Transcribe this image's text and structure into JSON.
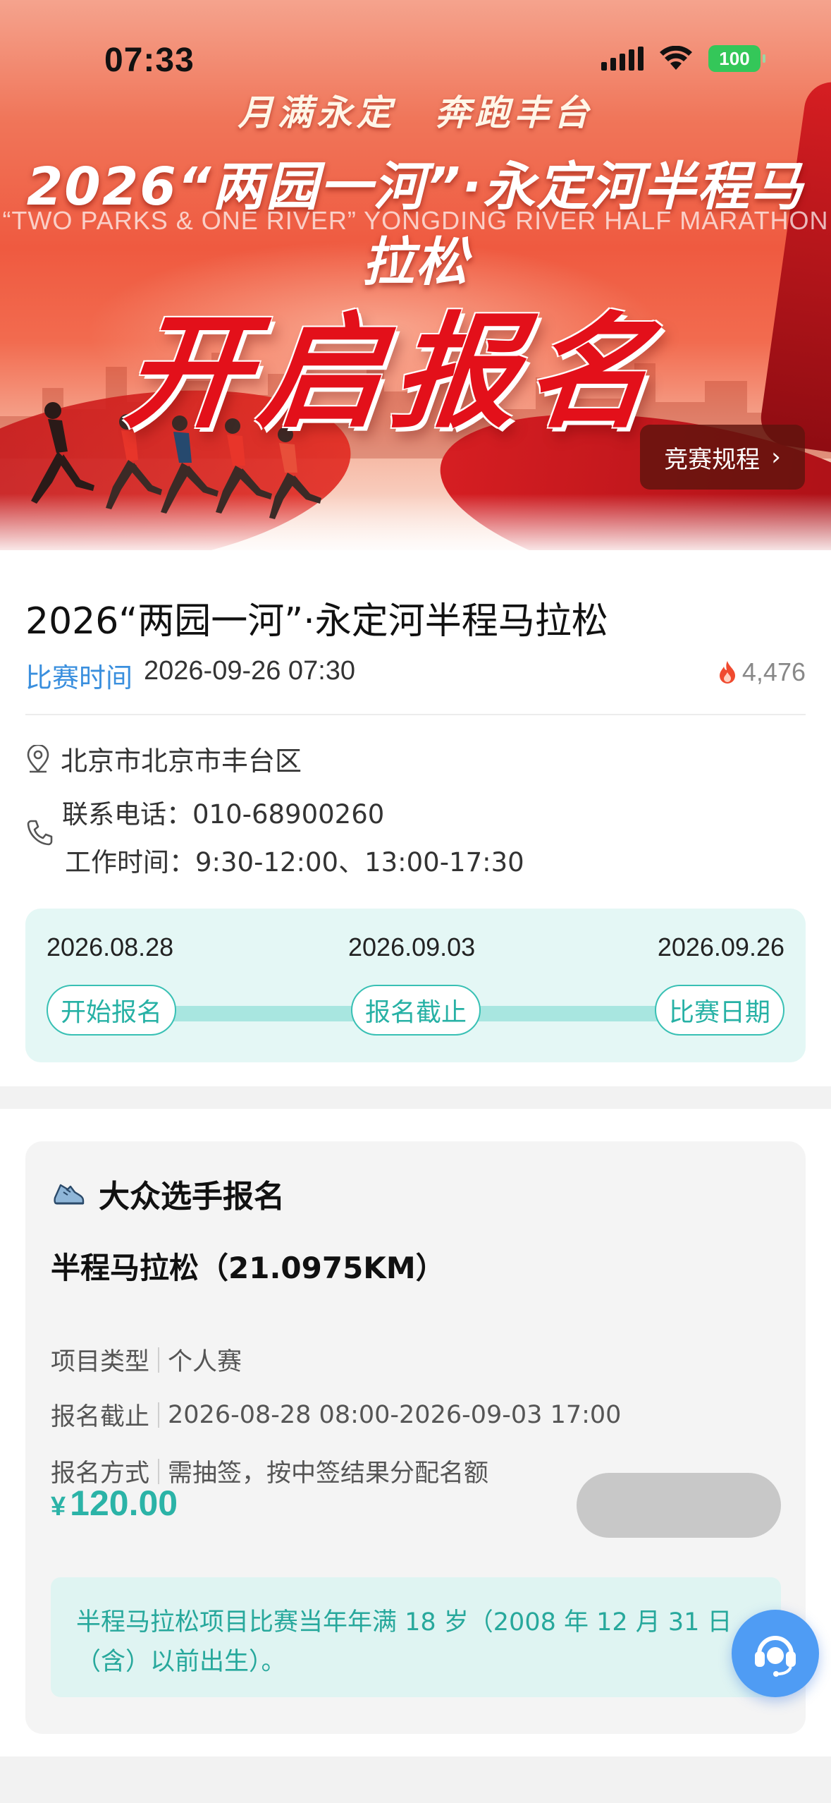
{
  "status_bar": {
    "time": "07:33",
    "battery": "100"
  },
  "banner": {
    "tagline": "月满永定　奔跑丰台",
    "title": "2026“两园一河”·永定河半程马拉松",
    "subtitle": "“TWO PARKS & ONE RIVER” YONGDING RIVER HALF MARATHON",
    "headline": "开启报名",
    "rules_button": "竞赛规程",
    "rules_chevron": "›"
  },
  "event": {
    "title": "2026“两园一河”·永定河半程马拉松",
    "time_label": "比赛时间",
    "time_value": "2026-09-26 07:30",
    "view_count": "4,476",
    "address": "北京市北京市丰台区",
    "phone": "联系电话：010-68900260",
    "hours": "工作时间：9:30-12:00、13:00-17:30"
  },
  "timeline": {
    "steps": [
      {
        "date": "2026.08.28",
        "label": "开始报名"
      },
      {
        "date": "2026.09.03",
        "label": "报名截止"
      },
      {
        "date": "2026.09.26",
        "label": "比赛日期"
      }
    ]
  },
  "registration": {
    "section_title": "大众选手报名",
    "project_name": "半程马拉松（21.0975KM）",
    "fields": [
      {
        "key": "项目类型",
        "value": "个人赛"
      },
      {
        "key": "报名截止",
        "value": "2026-08-28 08:00-2026-09-03 17:00"
      },
      {
        "key": "报名方式",
        "value": "需抽签，按中签结果分配名额"
      }
    ],
    "price_currency": "¥",
    "price_amount": "120.00",
    "notice": "半程马拉松项目比赛当年年满 18 岁（2008 年 12 月 31 日（含）以前出生）。"
  },
  "colors": {
    "accent_teal": "#2bb3a7",
    "link_blue": "#3a8fde",
    "banner_red": "#e3101a",
    "cs_blue": "#4f9cf4"
  },
  "icons": {
    "location": "location-pin-icon",
    "phone": "phone-icon",
    "fire": "fire-icon",
    "shoe": "running-shoe-icon",
    "customer_service": "headset-icon"
  }
}
